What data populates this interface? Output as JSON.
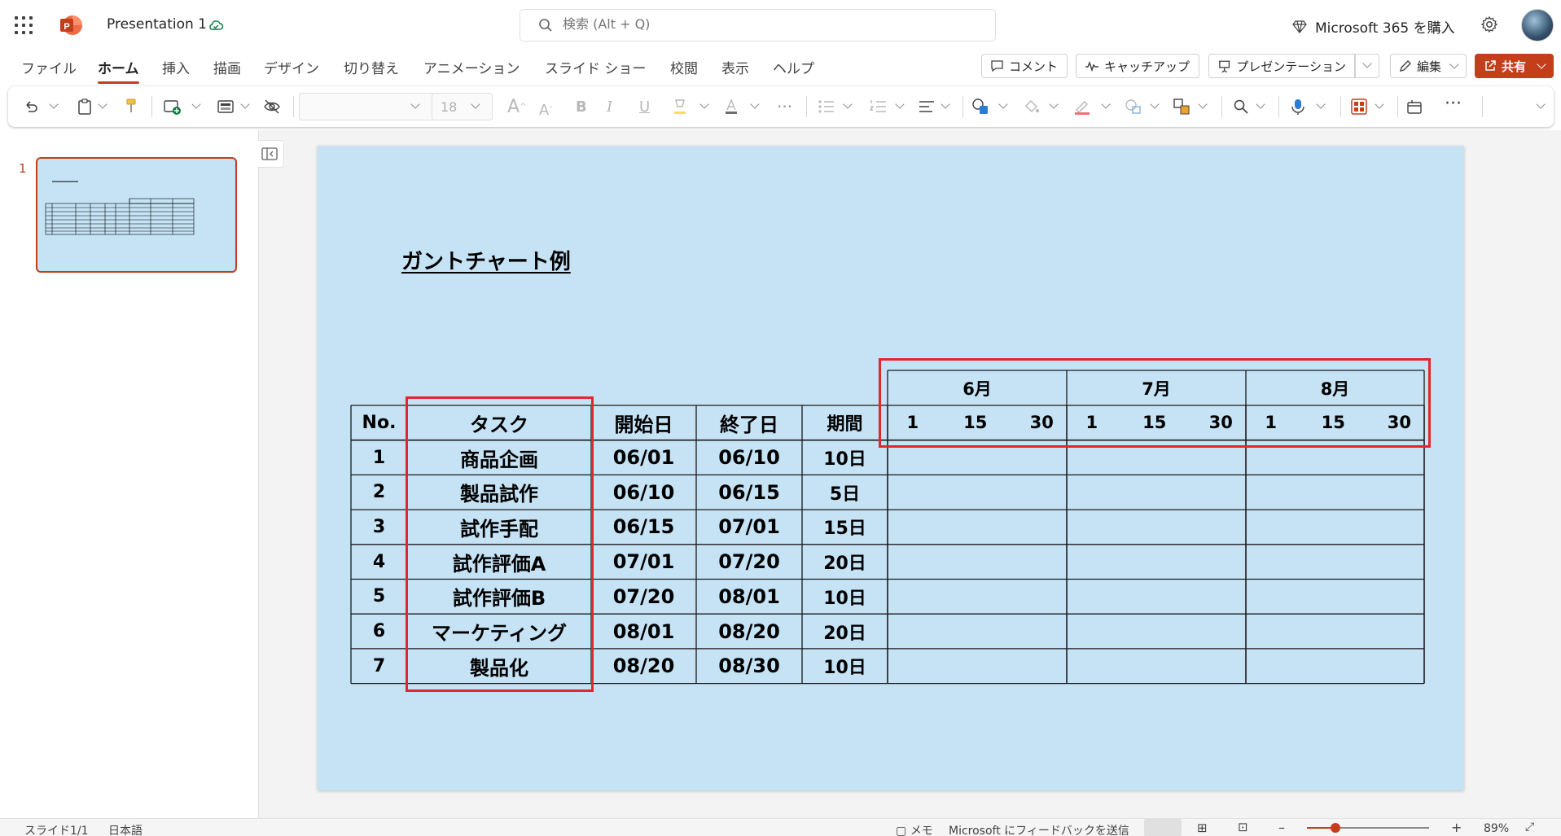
{
  "app": {
    "doc_title": "Presentation 1",
    "search_placeholder": "検索 (Alt + Q)",
    "buy_label": "Microsoft 365 を購入"
  },
  "ribbon": {
    "tabs": [
      "ファイル",
      "ホーム",
      "挿入",
      "描画",
      "デザイン",
      "切り替え",
      "アニメーション",
      "スライド ショー",
      "校閲",
      "表示",
      "ヘルプ"
    ],
    "active_tab": "ホーム",
    "comment_label": "コメント",
    "catchup_label": "キャッチアップ",
    "present_label": "プレゼンテーション",
    "edit_label": "編集",
    "share_label": "共有",
    "font_size": "18"
  },
  "thumbnails": [
    {
      "number": "1"
    }
  ],
  "slide": {
    "title": "ガントチャート例",
    "months": [
      "6月",
      "7月",
      "8月"
    ],
    "day_ticks": [
      "1",
      "15",
      "30"
    ],
    "headers": {
      "no": "No.",
      "task": "タスク",
      "start": "開始日",
      "end": "終了日",
      "duration": "期間"
    },
    "rows": [
      {
        "no": "1",
        "task": "商品企画",
        "start": "06/01",
        "end": "06/10",
        "duration": "10日"
      },
      {
        "no": "2",
        "task": "製品試作",
        "start": "06/10",
        "end": "06/15",
        "duration": "5日"
      },
      {
        "no": "3",
        "task": "試作手配",
        "start": "06/15",
        "end": "07/01",
        "duration": "15日"
      },
      {
        "no": "4",
        "task": "試作評価A",
        "start": "07/01",
        "end": "07/20",
        "duration": "20日"
      },
      {
        "no": "5",
        "task": "試作評価B",
        "start": "07/20",
        "end": "08/01",
        "duration": "10日"
      },
      {
        "no": "6",
        "task": "マーケティング",
        "start": "08/01",
        "end": "08/20",
        "duration": "20日"
      },
      {
        "no": "7",
        "task": "製品化",
        "start": "08/20",
        "end": "08/30",
        "duration": "10日"
      }
    ]
  },
  "status": {
    "slide_count": "スライド1/1",
    "language": "日本語",
    "notes_label": "メモ",
    "feedback_label": "Microsoft にフィードバックを送信",
    "zoom": "89%"
  },
  "colors": {
    "accent": "#c43e1c",
    "slide_bg": "#c5e3f5",
    "highlight": "#e3262c"
  }
}
